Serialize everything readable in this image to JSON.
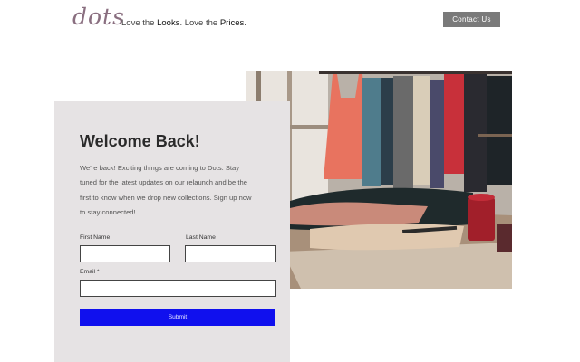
{
  "header": {
    "logo_text": "dots",
    "tagline_pre": "Love the ",
    "tagline_looks": "Looks",
    "tagline_mid": ". Love the ",
    "tagline_prices": "Prices",
    "tagline_end": ".",
    "contact_label": "Contact Us"
  },
  "form": {
    "title": "Welcome Back!",
    "text": "We're back! Exciting things are coming to Dots. Stay tuned for the latest updates on our relaunch and be the first to know when we drop new collections. Sign up now to stay connected!",
    "first_name_label": "First Name",
    "last_name_label": "Last Name",
    "email_label": "Email *",
    "first_name_value": "",
    "last_name_value": "",
    "email_value": "",
    "submit_label": "Submit"
  },
  "colors": {
    "accent": "#1010ee",
    "card_bg": "#e6e3e4",
    "contact_button": "#7a7a7a",
    "logo": "#8a6f80"
  }
}
